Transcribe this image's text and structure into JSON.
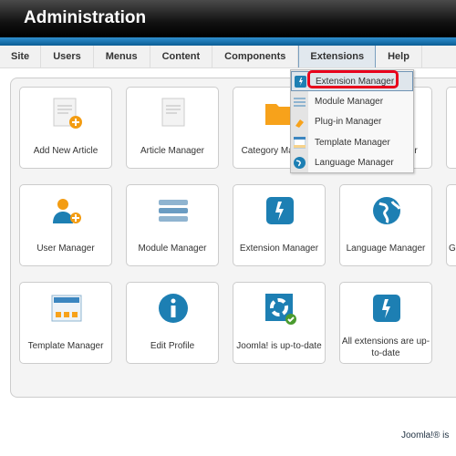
{
  "header": {
    "title": "Administration"
  },
  "menu": {
    "items": [
      "Site",
      "Users",
      "Menus",
      "Content",
      "Components",
      "Extensions",
      "Help"
    ],
    "active": "Extensions"
  },
  "dropdown": {
    "items": [
      {
        "label": "Extension Manager",
        "icon": "extension-icon",
        "highlighted": true
      },
      {
        "label": "Module Manager",
        "icon": "module-icon"
      },
      {
        "label": "Plug-in Manager",
        "icon": "plugin-icon"
      },
      {
        "label": "Template Manager",
        "icon": "template-icon"
      },
      {
        "label": "Language Manager",
        "icon": "language-icon"
      }
    ]
  },
  "cards": [
    {
      "label": "Add New Article",
      "icon": "add-article-icon"
    },
    {
      "label": "Article Manager",
      "icon": "article-icon"
    },
    {
      "label": "Category Manager",
      "icon": "folder-icon"
    },
    {
      "label": "Media Manager",
      "icon": "media-icon"
    },
    {
      "label": "",
      "icon": ""
    },
    {
      "label": "User Manager",
      "icon": "users-icon"
    },
    {
      "label": "Module Manager",
      "icon": "module-icon"
    },
    {
      "label": "Extension Manager",
      "icon": "extension-icon"
    },
    {
      "label": "Language Manager",
      "icon": "globe-icon"
    },
    {
      "label": "G",
      "icon": ""
    },
    {
      "label": "Template Manager",
      "icon": "template-icon"
    },
    {
      "label": "Edit Profile",
      "icon": "info-icon"
    },
    {
      "label": "Joomla! is up-to-date",
      "icon": "joomla-check-icon"
    },
    {
      "label": "All extensions are up-to-date",
      "icon": "extension-icon"
    }
  ],
  "footer": {
    "text": "Joomla!® is"
  },
  "colors": {
    "accent": "#0b5d94",
    "highlight": "#e8001c"
  }
}
